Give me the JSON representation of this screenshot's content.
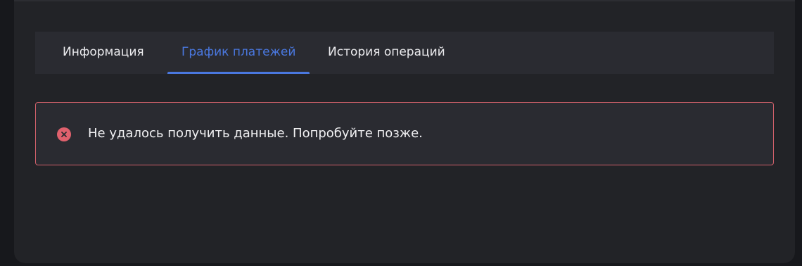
{
  "tabs": {
    "info_label": "Информация",
    "schedule_label": "График платежей",
    "history_label": "История операций",
    "active": "schedule"
  },
  "alert": {
    "message": "Не удалось получить данные. Попробуйте позже.",
    "icon": "error-circle-icon",
    "border_color": "#d0606a",
    "icon_color": "#e0616d"
  },
  "colors": {
    "accent": "#4a78e0",
    "background": "#17181c",
    "card": "#222327",
    "panel": "#2a2b31"
  }
}
